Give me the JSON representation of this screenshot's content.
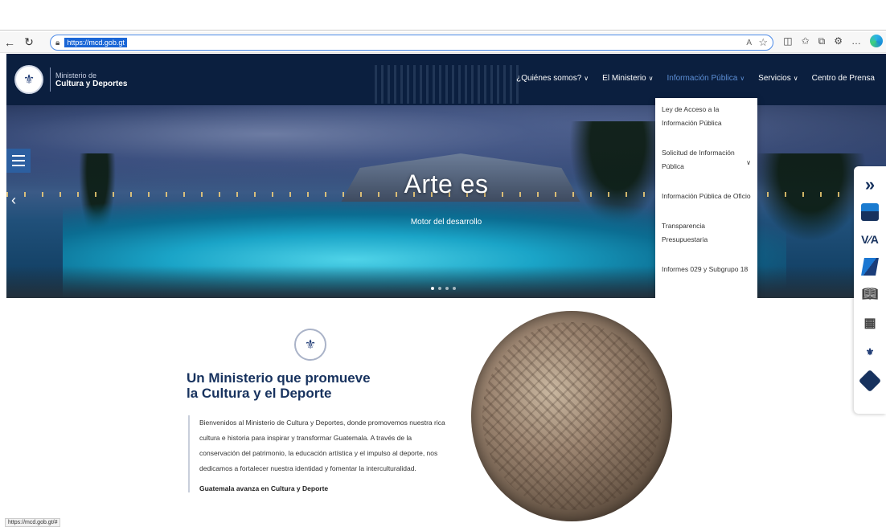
{
  "browser": {
    "url": "https://mcd.gob.gt",
    "status_url": "https://mcd.gob.gt/#"
  },
  "site": {
    "brand_line1": "Ministerio de",
    "brand_line2": "Cultura y Deportes",
    "nav": [
      {
        "label": "¿Quiénes somos?",
        "has_chevron": true
      },
      {
        "label": "El Ministerio",
        "has_chevron": true
      },
      {
        "label": "Información Pública",
        "has_chevron": true,
        "active": true
      },
      {
        "label": "Servicios",
        "has_chevron": true
      },
      {
        "label": "Centro de Prensa",
        "has_chevron": false
      }
    ],
    "dropdown": [
      "Ley de Acceso a la Información Pública",
      "Solicitud de Información Pública",
      "Información Pública de Oficio",
      "Transparencia Presupuestaria",
      "Informes 029 y Subgrupo 18"
    ],
    "hero": {
      "title": "Arte es",
      "subtitle": "Motor del desarrollo"
    },
    "intro": {
      "heading_line1": "Un Ministerio que promueve",
      "heading_line2": "la Cultura y el Deporte",
      "body": "Bienvenidos al Ministerio de Cultura y Deportes, donde promovemos nuestra rica cultura e historia para inspirar y transformar Guatemala. A través de la conservación del patrimonio, la educación artística y el impulso al deporte, nos dedicamos a fortalecer nuestra identidad y fomentar la interculturalidad.",
      "bold": "Guatemala avanza en Cultura y Deporte"
    }
  },
  "colors": {
    "nav_bg": "#0b1f3f",
    "accent": "#5d8fd6",
    "heading": "#17325e"
  }
}
